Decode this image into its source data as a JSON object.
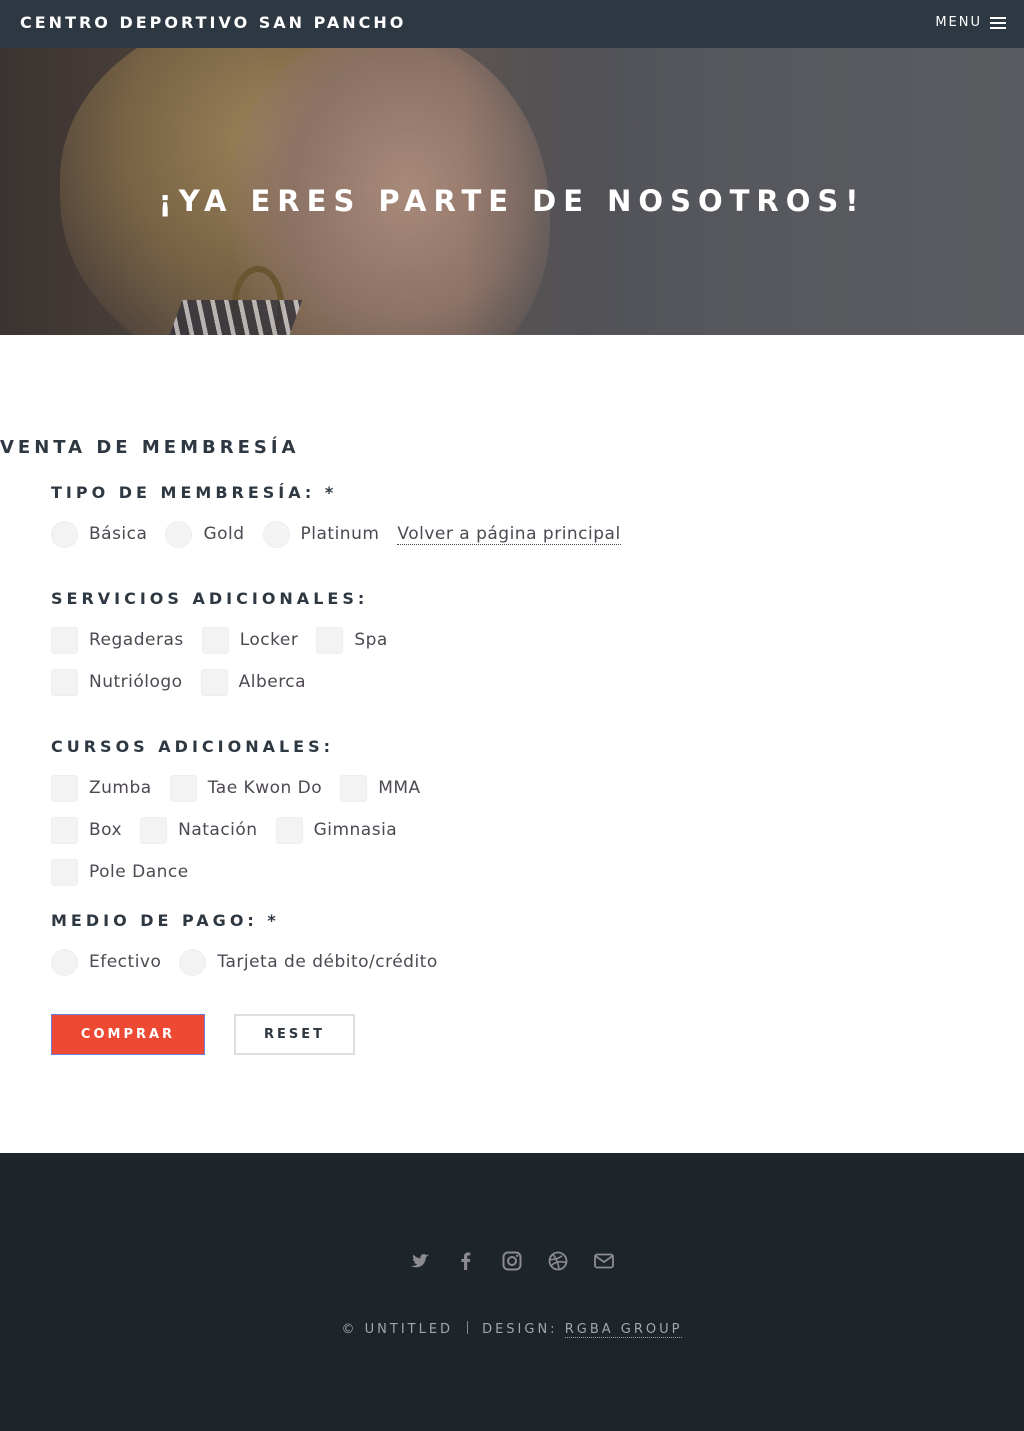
{
  "header": {
    "brand": "CENTRO DEPORTIVO SAN PANCHO",
    "menu_label": "MENU"
  },
  "hero": {
    "title": "¡YA ERES PARTE DE NOSOTROS!"
  },
  "form": {
    "section_title": "VENTA DE MEMBRESÍA",
    "membership": {
      "label": "TIPO DE MEMBRESÍA: *",
      "options": [
        "Básica",
        "Gold",
        "Platinum"
      ],
      "back_link": "Volver a página principal"
    },
    "services": {
      "label": "SERVICIOS ADICIONALES:",
      "options": [
        "Regaderas",
        "Locker",
        "Spa",
        "Nutriólogo",
        "Alberca"
      ]
    },
    "courses": {
      "label": "CURSOS ADICIONALES:",
      "options": [
        "Zumba",
        "Tae Kwon Do",
        "MMA",
        "Box",
        "Natación",
        "Gimnasia",
        "Pole Dance"
      ]
    },
    "payment": {
      "label": "MEDIO DE PAGO: *",
      "options": [
        "Efectivo",
        "Tarjeta de débito/crédito"
      ]
    },
    "buttons": {
      "submit": "COMPRAR",
      "reset": "RESET"
    }
  },
  "footer": {
    "social_icons": [
      "twitter-icon",
      "facebook-icon",
      "instagram-icon",
      "dribbble-icon",
      "envelope-icon"
    ],
    "copyright": "© UNTITLED",
    "design_prefix": "DESIGN:",
    "design_link": "RGBA GROUP"
  },
  "colors": {
    "header_bg": "#2e3842",
    "accent": "#ed4933",
    "footer_bg": "#1d242a",
    "text": "#4e4852"
  }
}
